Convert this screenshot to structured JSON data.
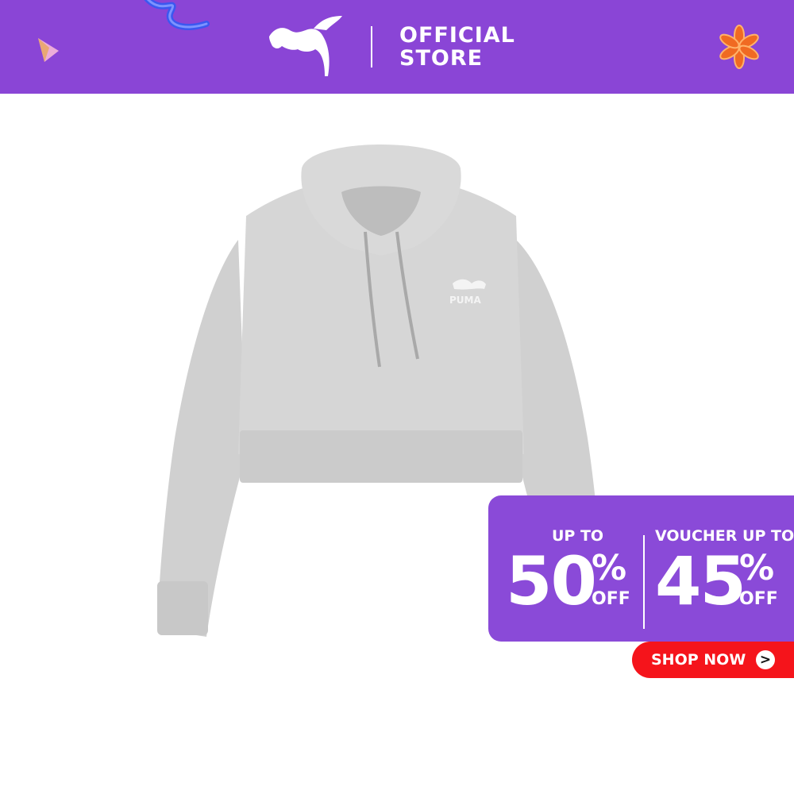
{
  "header": {
    "store_line1": "OFFICIAL",
    "store_line2": "STORE",
    "brand_icon": "puma-cat-logo",
    "background_color": "#8a45d6"
  },
  "promo": {
    "left_label": "UP TO",
    "left_value": "50",
    "left_symbol": "%",
    "left_off": "OFF",
    "right_label": "VOUCHER UP TO",
    "right_value": "45",
    "right_symbol": "%",
    "right_off": "OFF",
    "background_color": "#8a4ad8"
  },
  "cta": {
    "label": "SHOP NOW",
    "arrow": ">",
    "background_color": "#f5141b"
  },
  "product": {
    "item": "grey cropped hoodie",
    "color": "#d2d2d2",
    "logo_text": "PUMA"
  }
}
